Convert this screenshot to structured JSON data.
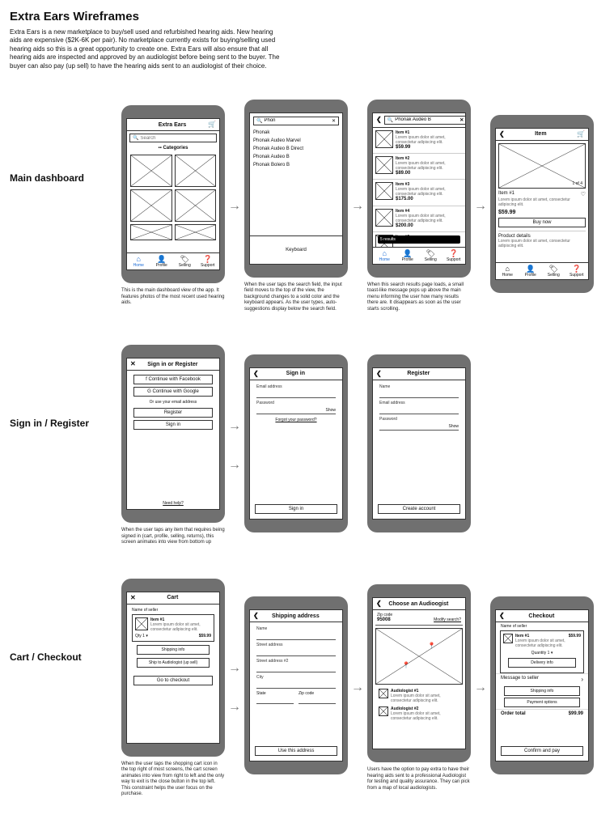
{
  "title": "Extra Ears Wireframes",
  "intro": "Extra Ears is a new marketplace to buy/sell used and refurbished hearing aids. New hearing aids are expensive ($2K-6K per pair). No marketplace currently exists for buying/selling used hearing aids so this is a great opportunity to create one. Extra Ears will also ensure that all hearing aids are inspected and approved by an audiologist before being sent to the buyer. The buyer can also pay (up sell) to have the  hearing aids sent to an audiologist of their choice.",
  "sections": {
    "dashboard": {
      "label": "Main dashboard",
      "s1": {
        "appTitle": "Extra Ears",
        "searchPlaceholder": "Search",
        "categories": "Categories",
        "tabs": [
          "Home",
          "Profile",
          "Selling",
          "Support"
        ],
        "caption": "This is the main dashboard view of the app. It features photos of the most recent used hearing aids."
      },
      "s2": {
        "query": "Phon",
        "suggestions": [
          "Phonak",
          "Phonak Audeo Marvel",
          "Phonak Audeo B Direct",
          "Phonak Audeo B",
          "Phonak Bolero B"
        ],
        "keyboard": "Keyboard",
        "clear": "✕",
        "caption": "When the user taps the search field, the input field moves to the top of the view, the background changes to a solid color and the keyboard appears. As the user types, auto-suggestions display below the search field."
      },
      "s3": {
        "query": "Phonak Audeo B",
        "toast": "5 results",
        "results": [
          {
            "t": "Item #1",
            "d": "Lorem ipsum dolor sit amet, consectetur adipiscing elit.",
            "p": "$59.99"
          },
          {
            "t": "Item #2",
            "d": "Lorem ipsum dolor sit amet, consectetur adipiscing elit.",
            "p": "$89.00"
          },
          {
            "t": "Item #3",
            "d": "Lorem ipsum dolor sit amet, consectetur adipiscing elit.",
            "p": "$175.00"
          },
          {
            "t": "Item #4",
            "d": "Lorem ipsum dolor sit amet, consectetur adipiscing elit.",
            "p": "$200.00"
          },
          {
            "t": "Item #5",
            "d": "",
            "p": ""
          }
        ],
        "caption": "When this search results page loads, a small toast-like message pops up above the main menu informing the user how many results there are. It disappears as soon as the user starts scrolling."
      },
      "s4": {
        "title": "Item",
        "itemTitle": "Item #1",
        "itemDesc": "Lorem ipsum dolor sit amet, consectetur adipiscing elit.",
        "price": "$59.99",
        "buy": "Buy now",
        "detailsHeader": "Product details",
        "detailsText": "Lorem ipsum dolor sit amet, consectetur adipiscing elit.",
        "count": "1 of 4"
      }
    },
    "signin": {
      "label": "Sign in / Register",
      "s1": {
        "title": "Sign in or Register",
        "fb": "Continue with Facebook",
        "google": "Continue with Google",
        "orText": "Or use your email address",
        "register": "Register",
        "signin": "Sign in",
        "help": "Need help?",
        "caption": "When the user taps any item that requires being signed in (cart, profile, selling, returns), this screen animates into view from bottom up"
      },
      "s2": {
        "title": "Sign in",
        "email": "Email address",
        "password": "Password",
        "show": "Show",
        "forgot": "Forgot your password?",
        "signinBtn": "Sign in"
      },
      "s3": {
        "title": "Register",
        "name": "Name",
        "email": "Email address",
        "password": "Password",
        "show": "Show",
        "create": "Create account"
      }
    },
    "cart": {
      "label": "Cart / Checkout",
      "s1": {
        "title": "Cart",
        "seller": "Name of seller",
        "itemTitle": "Item #1",
        "itemDesc": "Lorem ipsum dolor sit amet, consectetur adipiscing elit.",
        "qty": "Qty 1",
        "price": "$59.99",
        "shipping": "Shipping info",
        "audiologist": "Ship to Audiologist (up sell)",
        "checkout": "Go to checkout",
        "caption": "When the user taps the shopping cart icon in the top right of most screens, the cart screen animates into view from right to left and the only way to exit is the close button in the top left. This constraint helps the user focus on the purchase."
      },
      "s2": {
        "title": "Shipping address",
        "name": "Name",
        "street1": "Street address",
        "street2": "Street address #2",
        "city": "City",
        "state": "State",
        "zip": "Zip code",
        "use": "Use this address"
      },
      "s3": {
        "title": "Choose an Audioogist",
        "zipLabel": "Zip code",
        "zipVal": "95008",
        "modify": "Modify search?",
        "a1": "Audiologist #1",
        "a1d": "Lorem ipsum dolor sit amet, consectetur adipiscing elit.",
        "a2": "Audiologist #2",
        "a2d": "Lorem ipsum dolor sit amet, consectetur adipiscing elit.",
        "caption": "Users have the option to pay extra to have their hearing aids sent to a professional Audiologist for testing and quality assurance. They can pick from a map of local audiologists."
      },
      "s4": {
        "title": "Checkout",
        "seller": "Name of seller",
        "itemTitle": "Item #1",
        "price": "$59.99",
        "itemDesc": "Lorem ipsum dolor sit amet, consectetur adipiscing elit.",
        "qty": "Quantity 1",
        "delivery": "Delivery info",
        "msg": "Message to seller",
        "shipping": "Shipping info",
        "payment": "Payment options",
        "totalLabel": "Order total",
        "total": "$99.99",
        "confirm": "Confirm and pay"
      }
    }
  }
}
